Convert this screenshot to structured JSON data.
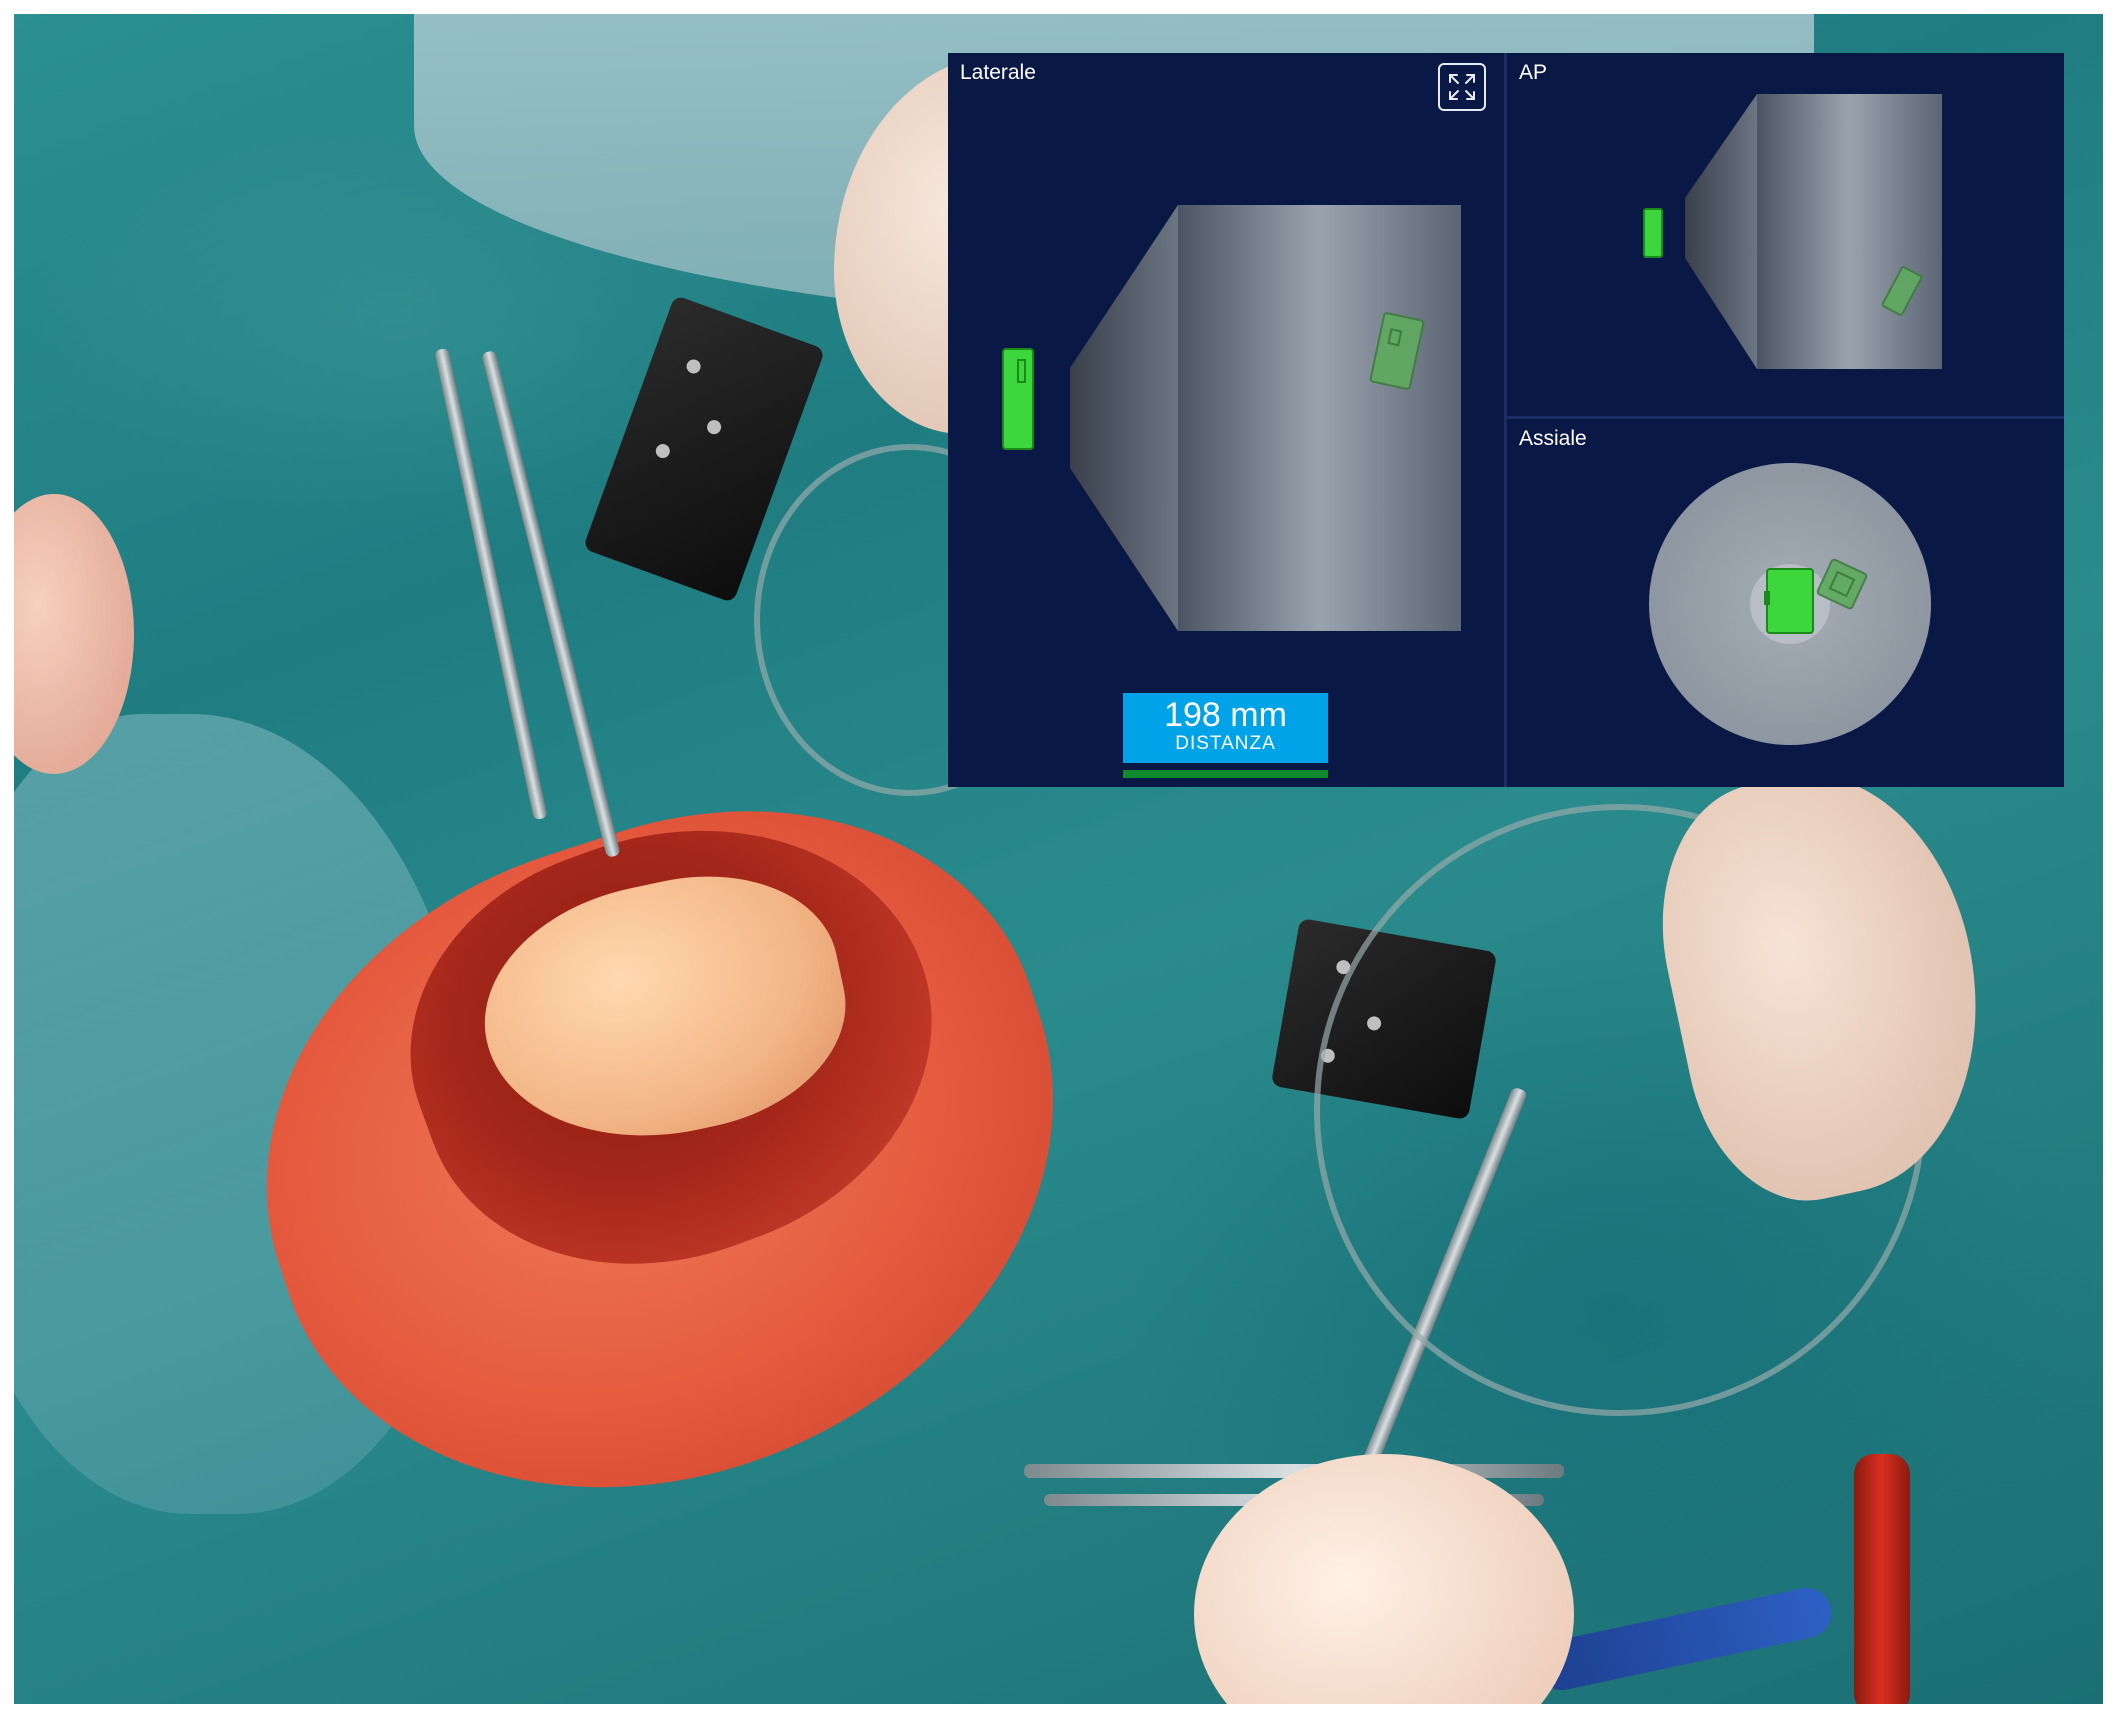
{
  "views": {
    "lateral": {
      "label": "Laterale"
    },
    "ap": {
      "label": "AP"
    },
    "axial": {
      "label": "Assiale"
    }
  },
  "distance": {
    "value": "198 mm",
    "label": "DISTANZA"
  },
  "icons": {
    "expand": "expand-arrows-icon"
  },
  "colors": {
    "panel_bg": "#0a1846",
    "accent_blue": "#00a3e8",
    "instrument_green": "#3dd63d",
    "target_green": "#5faa5f",
    "progress_green": "#0f8a2e"
  }
}
